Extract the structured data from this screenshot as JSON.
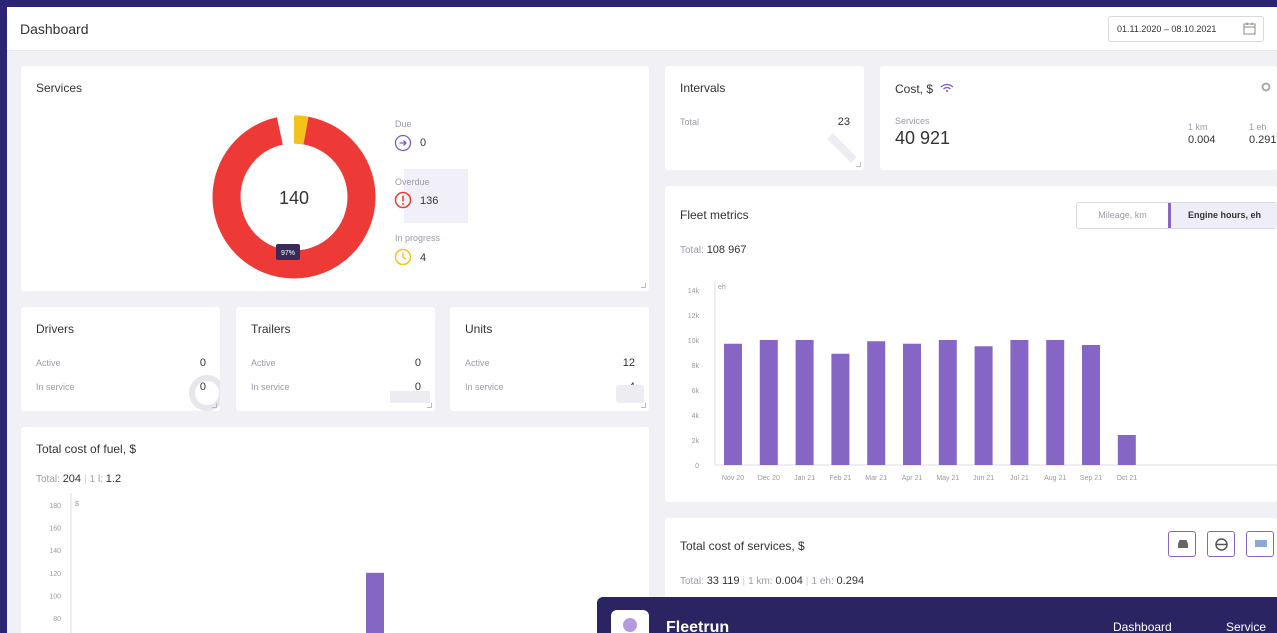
{
  "header": {
    "title": "Dashboard",
    "date_range": "01.11.2020 – 08.10.2021"
  },
  "services": {
    "title": "Services",
    "total": "140",
    "percent_label": "97%",
    "due": {
      "label": "Due",
      "value": "0"
    },
    "overdue": {
      "label": "Overdue",
      "value": "136"
    },
    "in_progress": {
      "label": "In progress",
      "value": "4"
    },
    "colors": {
      "overdue": "#ee3a36",
      "in_progress": "#f3c21c",
      "due": "#7a5cc4"
    }
  },
  "drivers": {
    "title": "Drivers",
    "active_label": "Active",
    "active": "0",
    "in_service_label": "In service",
    "in_service": "0"
  },
  "trailers": {
    "title": "Trailers",
    "active_label": "Active",
    "active": "0",
    "in_service_label": "In service",
    "in_service": "0"
  },
  "units": {
    "title": "Units",
    "active_label": "Active",
    "active": "12",
    "in_service_label": "In service",
    "in_service": "4"
  },
  "intervals": {
    "title": "Intervals",
    "total_label": "Total",
    "total": "23"
  },
  "cost": {
    "title": "Cost, $",
    "services_label": "Services",
    "services_value": "40 921",
    "per_km_label": "1 km",
    "per_km_value": "0.004",
    "per_eh_label": "1 eh",
    "per_eh_value": "0.291"
  },
  "fleet_metrics": {
    "title": "Fleet metrics",
    "tabs": [
      "Mileage, km",
      "Engine hours, eh"
    ],
    "active_tab": 1,
    "total_label": "Total:",
    "total_value": "108 967",
    "unit_tag": "eh"
  },
  "fuel": {
    "title": "Total cost of fuel, $",
    "total_label": "Total:",
    "total_value": "204",
    "per_l_label": "1 l:",
    "per_l_value": "1.2",
    "unit_tag": "$"
  },
  "services_cost": {
    "title": "Total cost of services, $",
    "total_label": "Total:",
    "total_value": "33 119",
    "per_km_label": "1 km:",
    "per_km_value": "0.004",
    "per_eh_label": "1 eh:",
    "per_eh_value": "0.294"
  },
  "app": {
    "name": "Fleetrun",
    "nav_dashboard": "Dashboard",
    "nav_service": "Service"
  },
  "accent_color": "#8666c4",
  "chart_data": [
    {
      "type": "bar",
      "title": "Fleet metrics",
      "categories": [
        "Nov 20",
        "Dec 20",
        "Jan 21",
        "Feb 21",
        "Mar 21",
        "Apr 21",
        "May 21",
        "Jun 21",
        "Jul 21",
        "Aug 21",
        "Sep 21",
        "Oct 21"
      ],
      "values": [
        9700,
        10000,
        10000,
        8900,
        9900,
        9700,
        10000,
        9500,
        10000,
        10000,
        9600,
        2400
      ],
      "yticks": [
        "0",
        "2k",
        "4k",
        "6k",
        "8k",
        "10k",
        "12k",
        "14k"
      ],
      "ylim": [
        0,
        14000
      ],
      "color": "#8666c4"
    },
    {
      "type": "bar",
      "title": "Total cost of fuel, $",
      "yticks": [
        "80",
        "100",
        "120",
        "140",
        "160",
        "180"
      ],
      "ylim": [
        60,
        180
      ],
      "visible_bar_value": 120,
      "color": "#8666c4"
    }
  ]
}
